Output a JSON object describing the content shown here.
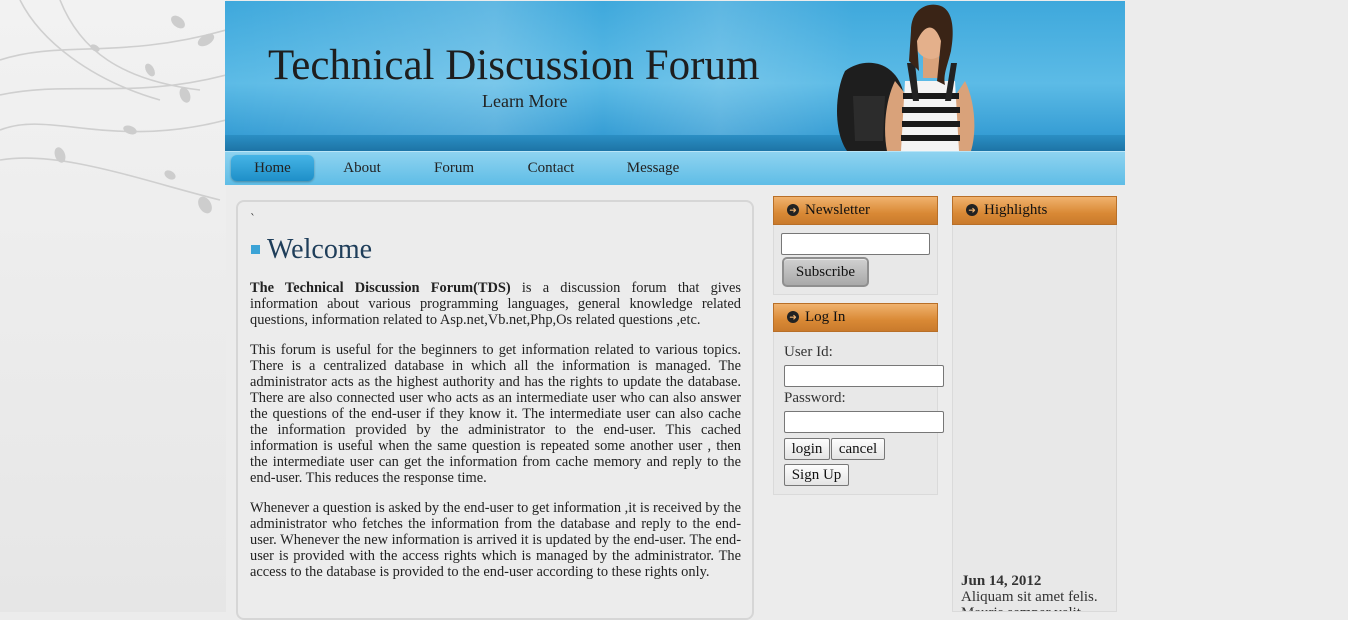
{
  "header": {
    "title": "Technical Discussion Forum",
    "subtitle": "Learn More"
  },
  "nav": {
    "items": [
      {
        "label": "Home",
        "active": true
      },
      {
        "label": "About",
        "active": false
      },
      {
        "label": "Forum",
        "active": false
      },
      {
        "label": "Contact",
        "active": false
      },
      {
        "label": "Message",
        "active": false
      }
    ]
  },
  "main": {
    "marker": "`",
    "heading": "Welcome",
    "intro_bold": "The Technical Discussion Forum(TDS)",
    "intro_rest": " is a discussion forum that gives information about various programming languages, general knowledge related questions, information related to Asp.net,Vb.net,Php,Os related questions ,etc.",
    "paragraph2": "This forum is useful for the beginners to get information related to various topics. There is a centralized database in which all the information is managed. The administrator acts as the highest authority and has the rights to update the database. There are also connected user who acts as an intermediate user who can also answer the questions of the end-user if they know it. The intermediate user can also cache the information provided by the administrator to the end-user. This cached information is useful when the same question is repeated some another user , then the intermediate user can get the information from cache memory and reply to the end-user. This reduces the response time.",
    "paragraph3": "Whenever a question is asked by the end-user to get information ,it is received by the administrator who fetches the information from the database and reply to the end-user. Whenever the new information is arrived it is updated by the end-user. The end-user is provided with the access rights which is managed by the administrator. The access to the database is provided to the end-user according to these rights only."
  },
  "newsletter": {
    "title": "Newsletter",
    "email_value": "",
    "subscribe_label": "Subscribe"
  },
  "login": {
    "title": "Log In",
    "userid_label": "User Id:",
    "userid_value": "",
    "password_label": "Password:",
    "password_value": "",
    "login_label": "login",
    "cancel_label": "cancel",
    "signup_label": "Sign Up"
  },
  "highlights": {
    "title": "Highlights",
    "date": "Jun 14, 2012",
    "text": "Aliquam sit amet felis. Mauris semper velit"
  },
  "colors": {
    "header_blue": "#3ea8dc",
    "nav_active": "#1e8fc8",
    "side_header_orange": "#d98935",
    "heading_blue": "#1f3e5a"
  }
}
